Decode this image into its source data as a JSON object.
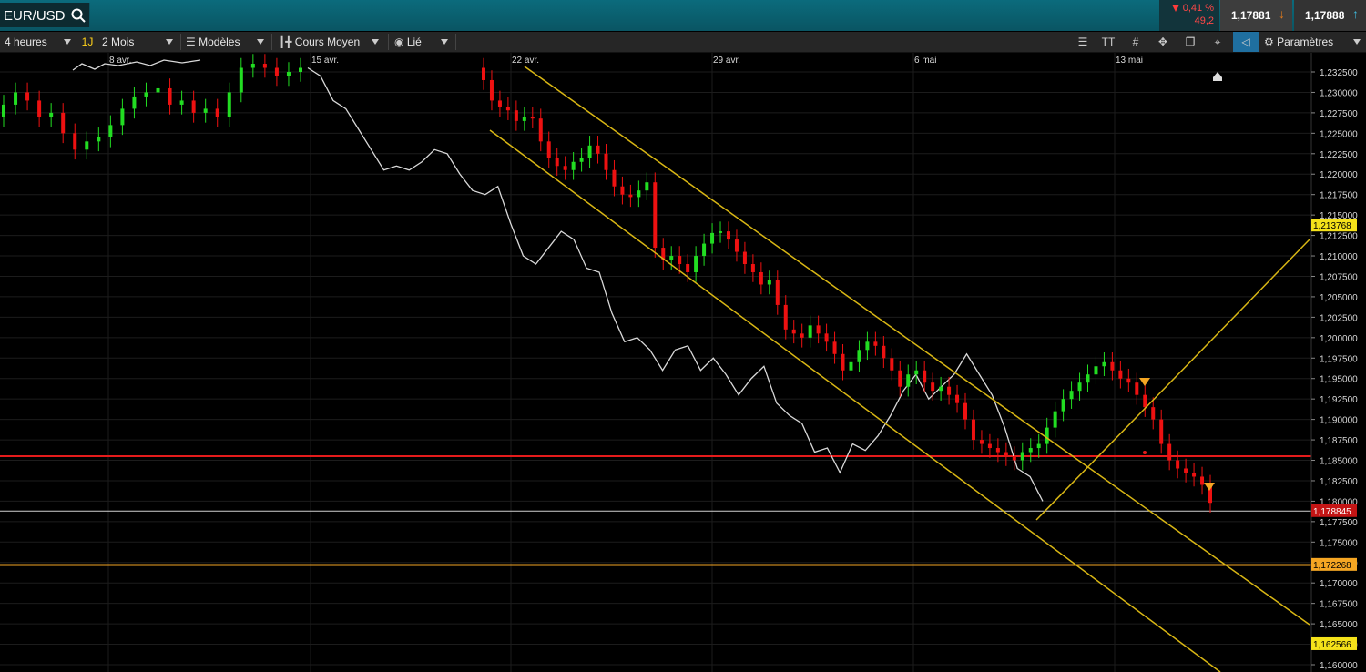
{
  "header": {
    "symbol": "EUR/USD",
    "change_pct": "0,41 %",
    "change_pts": "49,2",
    "bid": "1,17881",
    "ask": "1,17888"
  },
  "toolbar": {
    "interval": "4 heures",
    "period_shortcut": "1J",
    "range": "2 Mois",
    "templates": "Modèles",
    "indicator": "Cours Moyen",
    "link": "Lié",
    "settings": "Paramètres"
  },
  "colors": {
    "bull": "#22dd22",
    "bear": "#ee1111",
    "channel": "#d8b614",
    "support_red": "#e51b1b",
    "support_orange": "#f5a623",
    "overlay": "#d9d9d9"
  },
  "chart_data": {
    "type": "candlestick",
    "title": "",
    "ylim": [
      1.16,
      1.233
    ],
    "y_ticks": [
      "1,232500",
      "1,230000",
      "1,227500",
      "1,225000",
      "1,222500",
      "1,220000",
      "1,217500",
      "1,215000",
      "1,212500",
      "1,210000",
      "1,207500",
      "1,205000",
      "1,202500",
      "1,200000",
      "1,197500",
      "1,195000",
      "1,192500",
      "1,190000",
      "1,187500",
      "1,185000",
      "1,182500",
      "1,180000",
      "1,177500",
      "1,175000",
      "1,172500",
      "1,170000",
      "1,167500",
      "1,165000",
      "1,162500",
      "1,160000"
    ],
    "x_dates": [
      "8 avr.",
      "15 avr.",
      "22 avr.",
      "29 avr.",
      "6 mai",
      "13 mai"
    ],
    "price_tags": [
      {
        "label": "1,213768",
        "value": 1.213768,
        "kind": "channel"
      },
      {
        "label": "1,178845",
        "value": 1.178845,
        "kind": "last"
      },
      {
        "label": "1,172268",
        "value": 1.172268,
        "kind": "support"
      },
      {
        "label": "1,162566",
        "value": 1.162566,
        "kind": "channel"
      }
    ],
    "horizontal_lines": [
      {
        "value": 1.1855,
        "color": "red"
      },
      {
        "value": 1.1788,
        "color": "white"
      },
      {
        "value": 1.1722,
        "color": "orange"
      }
    ],
    "candles_ohlc_series": {
      "name": "EUR/USD 4h",
      "segments": [
        {
          "date_start": "8 avr.",
          "closes": [
            1.2285,
            1.23,
            1.229,
            1.227,
            1.2275,
            1.225,
            1.223,
            1.224,
            1.2245,
            1.226,
            1.228,
            1.2295,
            1.23,
            1.2305,
            1.2285,
            1.229,
            1.2275,
            1.228,
            1.227,
            1.23,
            1.233,
            1.2335,
            1.233,
            1.232,
            1.2325,
            1.233
          ]
        },
        {
          "date_start": "15 avr.",
          "closes": [
            1.233,
            1.2325,
            1.233,
            1.232,
            1.2325,
            1.232,
            1.2315,
            1.233,
            1.2325,
            1.232,
            1.233
          ]
        }
      ]
    },
    "channel_candles_closes": [
      1.2315,
      1.229,
      1.2282,
      1.2278,
      1.2265,
      1.227,
      1.2268,
      1.224,
      1.222,
      1.221,
      1.2205,
      1.2215,
      1.222,
      1.2235,
      1.2225,
      1.2205,
      1.2185,
      1.2175,
      1.2172,
      1.218,
      1.219,
      1.211,
      1.2095,
      1.21,
      1.209,
      1.208,
      1.21,
      1.2115,
      1.2128,
      1.213,
      1.212,
      1.2105,
      1.209,
      1.208,
      1.2065,
      1.207,
      1.204,
      1.201,
      1.2005,
      1.2,
      1.2015,
      1.2005,
      1.1995,
      1.198,
      1.196,
      1.197,
      1.1985,
      1.1995,
      1.199,
      1.1975,
      1.196,
      1.194,
      1.1955,
      1.196,
      1.1945,
      1.1935,
      1.194,
      1.193,
      1.192,
      1.19,
      1.1875,
      1.187,
      1.1865,
      1.186,
      1.1855,
      1.185,
      1.186,
      1.1865,
      1.187,
      1.189,
      1.191,
      1.1925,
      1.1935,
      1.1945,
      1.1955,
      1.1965,
      1.197,
      1.196,
      1.195,
      1.1945,
      1.193,
      1.1915,
      1.19,
      1.187,
      1.185,
      1.184,
      1.1835,
      1.183,
      1.182,
      1.1798
    ],
    "overlay_line_values": [
      1.233,
      1.232,
      1.229,
      1.228,
      1.2255,
      1.223,
      1.2205,
      1.221,
      1.2205,
      1.2215,
      1.223,
      1.2225,
      1.22,
      1.218,
      1.2175,
      1.2185,
      1.214,
      1.21,
      1.209,
      1.211,
      1.213,
      1.212,
      1.2085,
      1.208,
      1.203,
      1.1995,
      1.2,
      1.1985,
      1.196,
      1.1985,
      1.199,
      1.196,
      1.1975,
      1.1955,
      1.193,
      1.195,
      1.1965,
      1.192,
      1.1905,
      1.1895,
      1.186,
      1.1865,
      1.1835,
      1.187,
      1.1862,
      1.188,
      1.1905,
      1.1935,
      1.1955,
      1.1925,
      1.194,
      1.1955,
      1.198,
      1.1955,
      1.193,
      1.189,
      1.184,
      1.183,
      1.18
    ],
    "channel_lines": [
      {
        "from": [
          "22 avr.",
          1.2325
        ],
        "to": [
          "axis",
          1.1638
        ]
      },
      {
        "from": [
          "22 avr.",
          1.2255
        ],
        "to": [
          "axis",
          1.157
        ]
      },
      {
        "from": [
          "11 mai",
          1.1845
        ],
        "to": [
          "axis",
          1.2112
        ]
      }
    ]
  }
}
